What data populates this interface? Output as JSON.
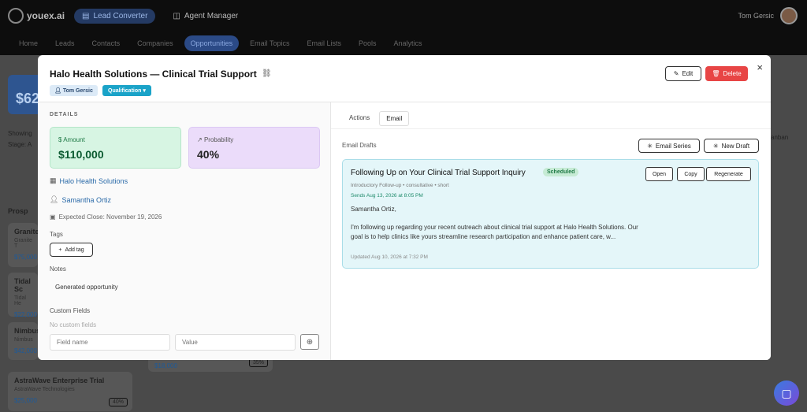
{
  "app": {
    "logo_text": "youex.ai",
    "top_tabs": [
      "Lead Converter",
      "Agent Manager"
    ],
    "user_name": "Tom Gersic",
    "nav": [
      "Home",
      "Leads",
      "Contacts",
      "Companies",
      "Opportunities",
      "Email Topics",
      "Email Lists",
      "Pools",
      "Analytics"
    ],
    "bg_cards": [
      {
        "title": "Granite",
        "sub": "Granite T",
        "value": "$75,000"
      },
      {
        "title": "Tidal Sc",
        "sub": "Tidal He",
        "value": "$22,000"
      },
      {
        "title": "Nimbus",
        "sub": "Nimbus",
        "value": "$42,000"
      },
      {
        "title": "AstraWave Enterprise Trial",
        "sub": "AstraWave Technologies",
        "value": "$25,000",
        "badge": "40%"
      }
    ],
    "bg_mid_card": {
      "value": "$18,000",
      "badge": "35%"
    },
    "bg_total_prefix": "$62",
    "bg_showing": "Showing",
    "bg_stage": "Stage: A",
    "bg_prosp": "Prosp",
    "bg_kanban": "anban"
  },
  "modal": {
    "title": "Halo Health Solutions — Clinical Trial Support",
    "owner_tag": "Tom Gersic",
    "stage_tag": "Qualification",
    "edit_label": "Edit",
    "delete_label": "Delete",
    "details_label": "DETAILS",
    "amount_label": "Amount",
    "amount_value": "$110,000",
    "probability_label": "Probability",
    "probability_value": "40%",
    "company": "Halo Health Solutions",
    "contact": "Samantha Ortiz",
    "expected_close": "Expected Close: November 19, 2026",
    "tags_label": "Tags",
    "add_tag_label": "Add tag",
    "notes_label": "Notes",
    "notes_value": "Generated opportunity",
    "custom_fields_label": "Custom Fields",
    "no_custom_fields": "No custom fields",
    "field_name_placeholder": "Field name",
    "value_placeholder": "Value",
    "tabs": [
      "Actions",
      "Email"
    ],
    "email_drafts_label": "Email Drafts",
    "email_series_label": "Email Series",
    "new_draft_label": "New Draft",
    "draft": {
      "title": "Following Up on Your Clinical Trial Support Inquiry",
      "status": "Scheduled",
      "meta": "Introductory Follow-up • consultative • short",
      "sends": "Sends Aug 13, 2026 at 8:05 PM",
      "greeting": "Samantha Ortiz,",
      "body": "I'm following up regarding your recent outreach about clinical trial support at Halo Health Solutions. Our goal is to help clinics like yours streamline research participation and enhance patient care, w...",
      "updated": "Updated Aug 10, 2026 at 7:32 PM",
      "open_label": "Open",
      "copy_label": "Copy",
      "regenerate_label": "Regenerate"
    }
  }
}
